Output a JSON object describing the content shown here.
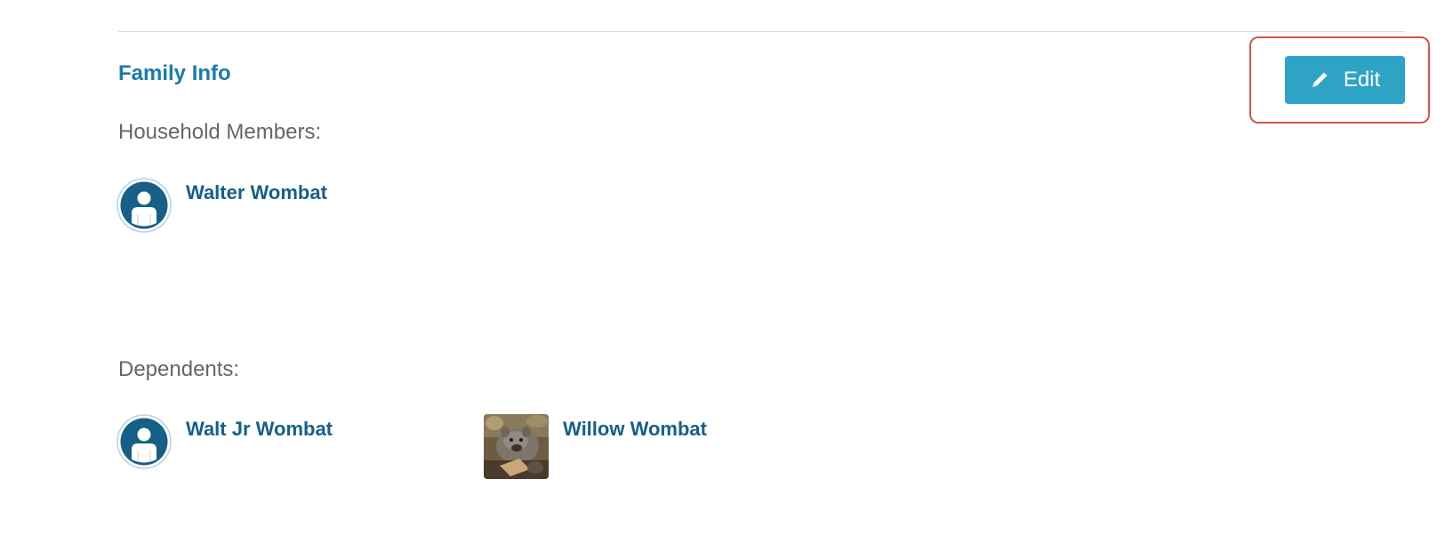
{
  "section": {
    "title": "Family Info",
    "edit_label": "Edit"
  },
  "household": {
    "label": "Household Members:",
    "members": [
      {
        "name": "Walter Wombat",
        "avatar": "default-person-icon"
      }
    ]
  },
  "dependents": {
    "label": "Dependents:",
    "members": [
      {
        "name": "Walt Jr Wombat",
        "avatar": "default-person-icon"
      },
      {
        "name": "Willow Wombat",
        "avatar": "wombat-photo"
      }
    ]
  },
  "colors": {
    "title": "#1a7ab0",
    "name": "#155f8a",
    "button": "#2ea3c6",
    "highlight": "#d9534f"
  }
}
